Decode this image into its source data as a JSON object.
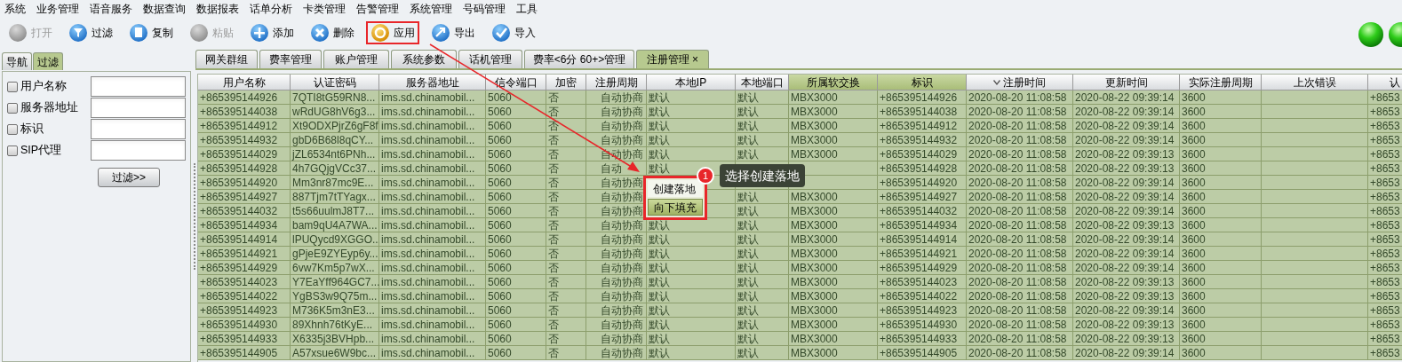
{
  "menu_bar": [
    "系统",
    "业务管理",
    "语音服务",
    "数据查询",
    "数据报表",
    "话单分析",
    "卡类管理",
    "告警管理",
    "系统管理",
    "号码管理",
    "工具"
  ],
  "toolbar": [
    {
      "label": "打开",
      "disabled": true,
      "highlighted": false
    },
    {
      "label": "过滤",
      "disabled": false,
      "highlighted": false
    },
    {
      "label": "复制",
      "disabled": false,
      "highlighted": false
    },
    {
      "label": "粘贴",
      "disabled": true,
      "highlighted": false
    },
    {
      "label": "添加",
      "disabled": false,
      "highlighted": false
    },
    {
      "label": "删除",
      "disabled": false,
      "highlighted": false
    },
    {
      "label": "应用",
      "disabled": false,
      "highlighted": true
    },
    {
      "label": "导出",
      "disabled": false,
      "highlighted": false
    },
    {
      "label": "导入",
      "disabled": false,
      "highlighted": false
    }
  ],
  "left_panel": {
    "tabs": [
      {
        "label": "导航",
        "selected": false
      },
      {
        "label": "过滤",
        "selected": true
      }
    ],
    "filters": [
      {
        "label": "用户名称",
        "checked": false
      },
      {
        "label": "服务器地址",
        "checked": false
      },
      {
        "label": "标识",
        "checked": false
      },
      {
        "label": "SIP代理",
        "checked": false
      }
    ],
    "filter_button": "过滤>>"
  },
  "tabs": [
    {
      "label": "网关群组",
      "selected": false
    },
    {
      "label": "费率管理",
      "selected": false
    },
    {
      "label": "账户管理",
      "selected": false
    },
    {
      "label": "系统参数",
      "selected": false
    },
    {
      "label": "话机管理",
      "selected": false
    },
    {
      "label": "费率<6分 60+>管理",
      "selected": false
    },
    {
      "label": "注册管理",
      "selected": true,
      "close": "×"
    }
  ],
  "table": {
    "columns": [
      {
        "label": "用户名称",
        "highlighted": false,
        "sorted": false
      },
      {
        "label": "认证密码",
        "highlighted": false,
        "sorted": false
      },
      {
        "label": "服务器地址",
        "highlighted": false,
        "sorted": false
      },
      {
        "label": "信令端口",
        "highlighted": false,
        "sorted": false
      },
      {
        "label": "加密",
        "highlighted": false,
        "sorted": false
      },
      {
        "label": "注册周期",
        "highlighted": false,
        "sorted": false
      },
      {
        "label": "本地IP",
        "highlighted": false,
        "sorted": false
      },
      {
        "label": "本地端口",
        "highlighted": false,
        "sorted": false
      },
      {
        "label": "所属软交换",
        "highlighted": true,
        "sorted": false
      },
      {
        "label": "标识",
        "highlighted": true,
        "sorted": false
      },
      {
        "label": "注册时间",
        "highlighted": false,
        "sorted": true
      },
      {
        "label": "更新时间",
        "highlighted": false,
        "sorted": false
      },
      {
        "label": "实际注册周期",
        "highlighted": false,
        "sorted": false
      },
      {
        "label": "上次错误",
        "highlighted": false,
        "sorted": false
      },
      {
        "label": "认",
        "highlighted": false,
        "sorted": false
      }
    ],
    "rows": [
      [
        "+865395144926",
        "7QTI8tG59RN8...",
        "ims.sd.chinamobil...",
        "5060",
        "否",
        "自动协商",
        "默认",
        "默认",
        "MBX3000",
        "+865395144926",
        "2020-08-20 11:08:58",
        "2020-08-22 09:39:14",
        "3600",
        null,
        "+8653"
      ],
      [
        "+865395144038",
        "wRdUG8hV6g3...",
        "ims.sd.chinamobil...",
        "5060",
        "否",
        "自动协商",
        "默认",
        "默认",
        "MBX3000",
        "+865395144038",
        "2020-08-20 11:08:58",
        "2020-08-22 09:39:14",
        "3600",
        null,
        "+8653"
      ],
      [
        "+865395144912",
        "Xt9ODXPjrZ6gF8f",
        "ims.sd.chinamobil...",
        "5060",
        "否",
        "自动协商",
        "默认",
        "默认",
        "MBX3000",
        "+865395144912",
        "2020-08-20 11:08:58",
        "2020-08-22 09:39:14",
        "3600",
        null,
        "+8653"
      ],
      [
        "+865395144932",
        "gbD6B68l8qCY...",
        "ims.sd.chinamobil...",
        "5060",
        "否",
        "自动协商",
        "默认",
        "默认",
        "MBX3000",
        "+865395144932",
        "2020-08-20 11:08:58",
        "2020-08-22 09:39:14",
        "3600",
        null,
        "+8653"
      ],
      [
        "+865395144029",
        "jZL6534nt6PNh...",
        "ims.sd.chinamobil...",
        "5060",
        "否",
        "自动协商",
        "默认",
        "默认",
        "MBX3000",
        "+865395144029",
        "2020-08-20 11:08:58",
        "2020-08-22 09:39:13",
        "3600",
        null,
        "+8653"
      ],
      [
        "+865395144928",
        "4h7GQjgVCc37...",
        "ims.sd.chinamobil...",
        "5060",
        "否",
        "自动",
        "默认",
        null,
        null,
        "+865395144928",
        "2020-08-20 11:08:58",
        "2020-08-22 09:39:13",
        "3600",
        null,
        "+8653"
      ],
      [
        "+865395144920",
        "Mm3nr87mc9E...",
        "ims.sd.chinamobil...",
        "5060",
        "否",
        "自动协商",
        null,
        null,
        null,
        "+865395144920",
        "2020-08-20 11:08:58",
        "2020-08-22 09:39:14",
        "3600",
        null,
        "+8653"
      ],
      [
        "+865395144927",
        "887Tjm7tTYagx...",
        "ims.sd.chinamobil...",
        "5060",
        "否",
        "自动协商",
        null,
        "默认",
        "MBX3000",
        "+865395144927",
        "2020-08-20 11:08:58",
        "2020-08-22 09:39:14",
        "3600",
        null,
        "+8653"
      ],
      [
        "+865395144032",
        "t5s66uulmJ8T7...",
        "ims.sd.chinamobil...",
        "5060",
        "否",
        "自动协商",
        null,
        "默认",
        "MBX3000",
        "+865395144032",
        "2020-08-20 11:08:58",
        "2020-08-22 09:39:14",
        "3600",
        null,
        "+8653"
      ],
      [
        "+865395144934",
        "bam9qU4A7WA...",
        "ims.sd.chinamobil...",
        "5060",
        "否",
        "自动协商",
        "默认",
        "默认",
        "MBX3000",
        "+865395144934",
        "2020-08-20 11:08:58",
        "2020-08-22 09:39:13",
        "3600",
        null,
        "+8653"
      ],
      [
        "+865395144914",
        "lPUQycd9XGGO...",
        "ims.sd.chinamobil...",
        "5060",
        "否",
        "自动协商",
        "默认",
        "默认",
        "MBX3000",
        "+865395144914",
        "2020-08-20 11:08:58",
        "2020-08-22 09:39:14",
        "3600",
        null,
        "+8653"
      ],
      [
        "+865395144921",
        "gPjeE9ZYEyp6y...",
        "ims.sd.chinamobil...",
        "5060",
        "否",
        "自动协商",
        "默认",
        "默认",
        "MBX3000",
        "+865395144921",
        "2020-08-20 11:08:58",
        "2020-08-22 09:39:14",
        "3600",
        null,
        "+8653"
      ],
      [
        "+865395144929",
        "6vw7Km5p7wX...",
        "ims.sd.chinamobil...",
        "5060",
        "否",
        "自动协商",
        "默认",
        "默认",
        "MBX3000",
        "+865395144929",
        "2020-08-20 11:08:58",
        "2020-08-22 09:39:14",
        "3600",
        null,
        "+8653"
      ],
      [
        "+865395144023",
        "Y7EaYff964GC7...",
        "ims.sd.chinamobil...",
        "5060",
        "否",
        "自动协商",
        "默认",
        "默认",
        "MBX3000",
        "+865395144023",
        "2020-08-20 11:08:58",
        "2020-08-22 09:39:13",
        "3600",
        null,
        "+8653"
      ],
      [
        "+865395144022",
        "YgBS3w9Q75m...",
        "ims.sd.chinamobil...",
        "5060",
        "否",
        "自动协商",
        "默认",
        "默认",
        "MBX3000",
        "+865395144022",
        "2020-08-20 11:08:58",
        "2020-08-22 09:39:13",
        "3600",
        null,
        "+8653"
      ],
      [
        "+865395144923",
        "M736K5m3nE3...",
        "ims.sd.chinamobil...",
        "5060",
        "否",
        "自动协商",
        "默认",
        "默认",
        "MBX3000",
        "+865395144923",
        "2020-08-20 11:08:58",
        "2020-08-22 09:39:14",
        "3600",
        null,
        "+8653"
      ],
      [
        "+865395144930",
        "89Xhnh76tKyE...",
        "ims.sd.chinamobil...",
        "5060",
        "否",
        "自动协商",
        "默认",
        "默认",
        "MBX3000",
        "+865395144930",
        "2020-08-20 11:08:58",
        "2020-08-22 09:39:13",
        "3600",
        null,
        "+8653"
      ],
      [
        "+865395144933",
        "X6335j3BVHpb...",
        "ims.sd.chinamobil...",
        "5060",
        "否",
        "自动协商",
        "默认",
        "默认",
        "MBX3000",
        "+865395144933",
        "2020-08-20 11:08:58",
        "2020-08-22 09:39:13",
        "3600",
        null,
        "+8653"
      ],
      [
        "+865395144905",
        "A57xsue6W9bc...",
        "ims.sd.chinamobil...",
        "5060",
        "否",
        "自动协商",
        "默认",
        "默认",
        "MBX3000",
        "+865395144905",
        "2020-08-20 11:08:58",
        "2020-08-22 09:39:14",
        "3600",
        null,
        "+8653"
      ]
    ]
  },
  "context_menu": {
    "items": [
      {
        "label": "创建落地",
        "selected": false
      },
      {
        "label": "向下填充",
        "selected": true
      }
    ]
  },
  "callout": {
    "badge": "1",
    "text": "选择创建落地"
  }
}
